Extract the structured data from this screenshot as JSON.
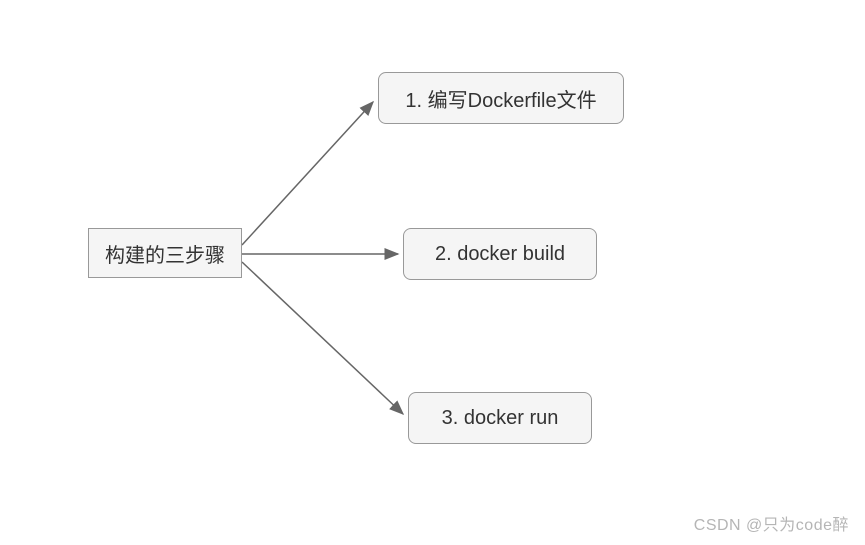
{
  "diagram": {
    "root": "构建的三步骤",
    "steps": [
      "1. 编写Dockerfile文件",
      "2. docker build",
      "3. docker run"
    ]
  },
  "watermark": "CSDN @只为code醉"
}
